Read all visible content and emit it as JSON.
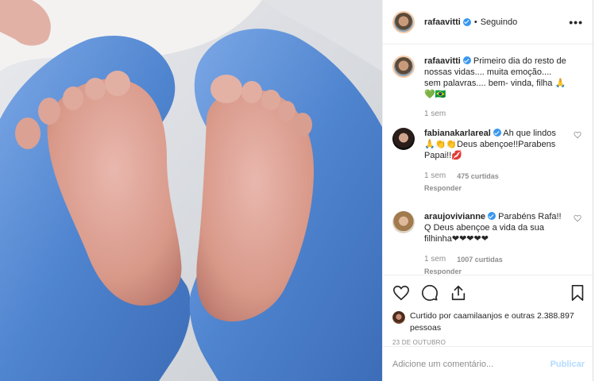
{
  "post": {
    "author": "rafaavitti",
    "follow_separator": "•",
    "follow_status": "Seguindo",
    "more_icon": "•••"
  },
  "caption": {
    "author": "rafaavitti",
    "text": "Primeiro dia do resto de nossas vidas.... muita emoção.... sem palavras.... bem- vinda, filha 🙏💚🇧🇷",
    "time": "1 sem"
  },
  "comments": [
    {
      "author": "fabianakarlareal",
      "text": "Ah que lindos 🙏👏👏Deus abençoe!!Parabens Papai!!💋",
      "time": "1 sem",
      "likes": "475 curtidas",
      "reply": "Responder"
    },
    {
      "author": "araujovivianne",
      "text": "Parabéns Rafa!! Q Deus abençoe a vida da sua filhinha❤❤❤❤❤",
      "time": "1 sem",
      "likes": "1007 curtidas",
      "reply": "Responder"
    }
  ],
  "likes_line": {
    "prefix": "Curtido por",
    "user": "caamilaanjos",
    "suffix": "e outras 2.388.897 pessoas"
  },
  "date": "23 DE OUTUBRO",
  "add_comment": {
    "placeholder": "Adicione um comentário...",
    "publish": "Publicar"
  },
  "colors": {
    "verified": "#3897f0",
    "publish_disabled": "#b3dbff",
    "glove": "#5b8fd6"
  }
}
